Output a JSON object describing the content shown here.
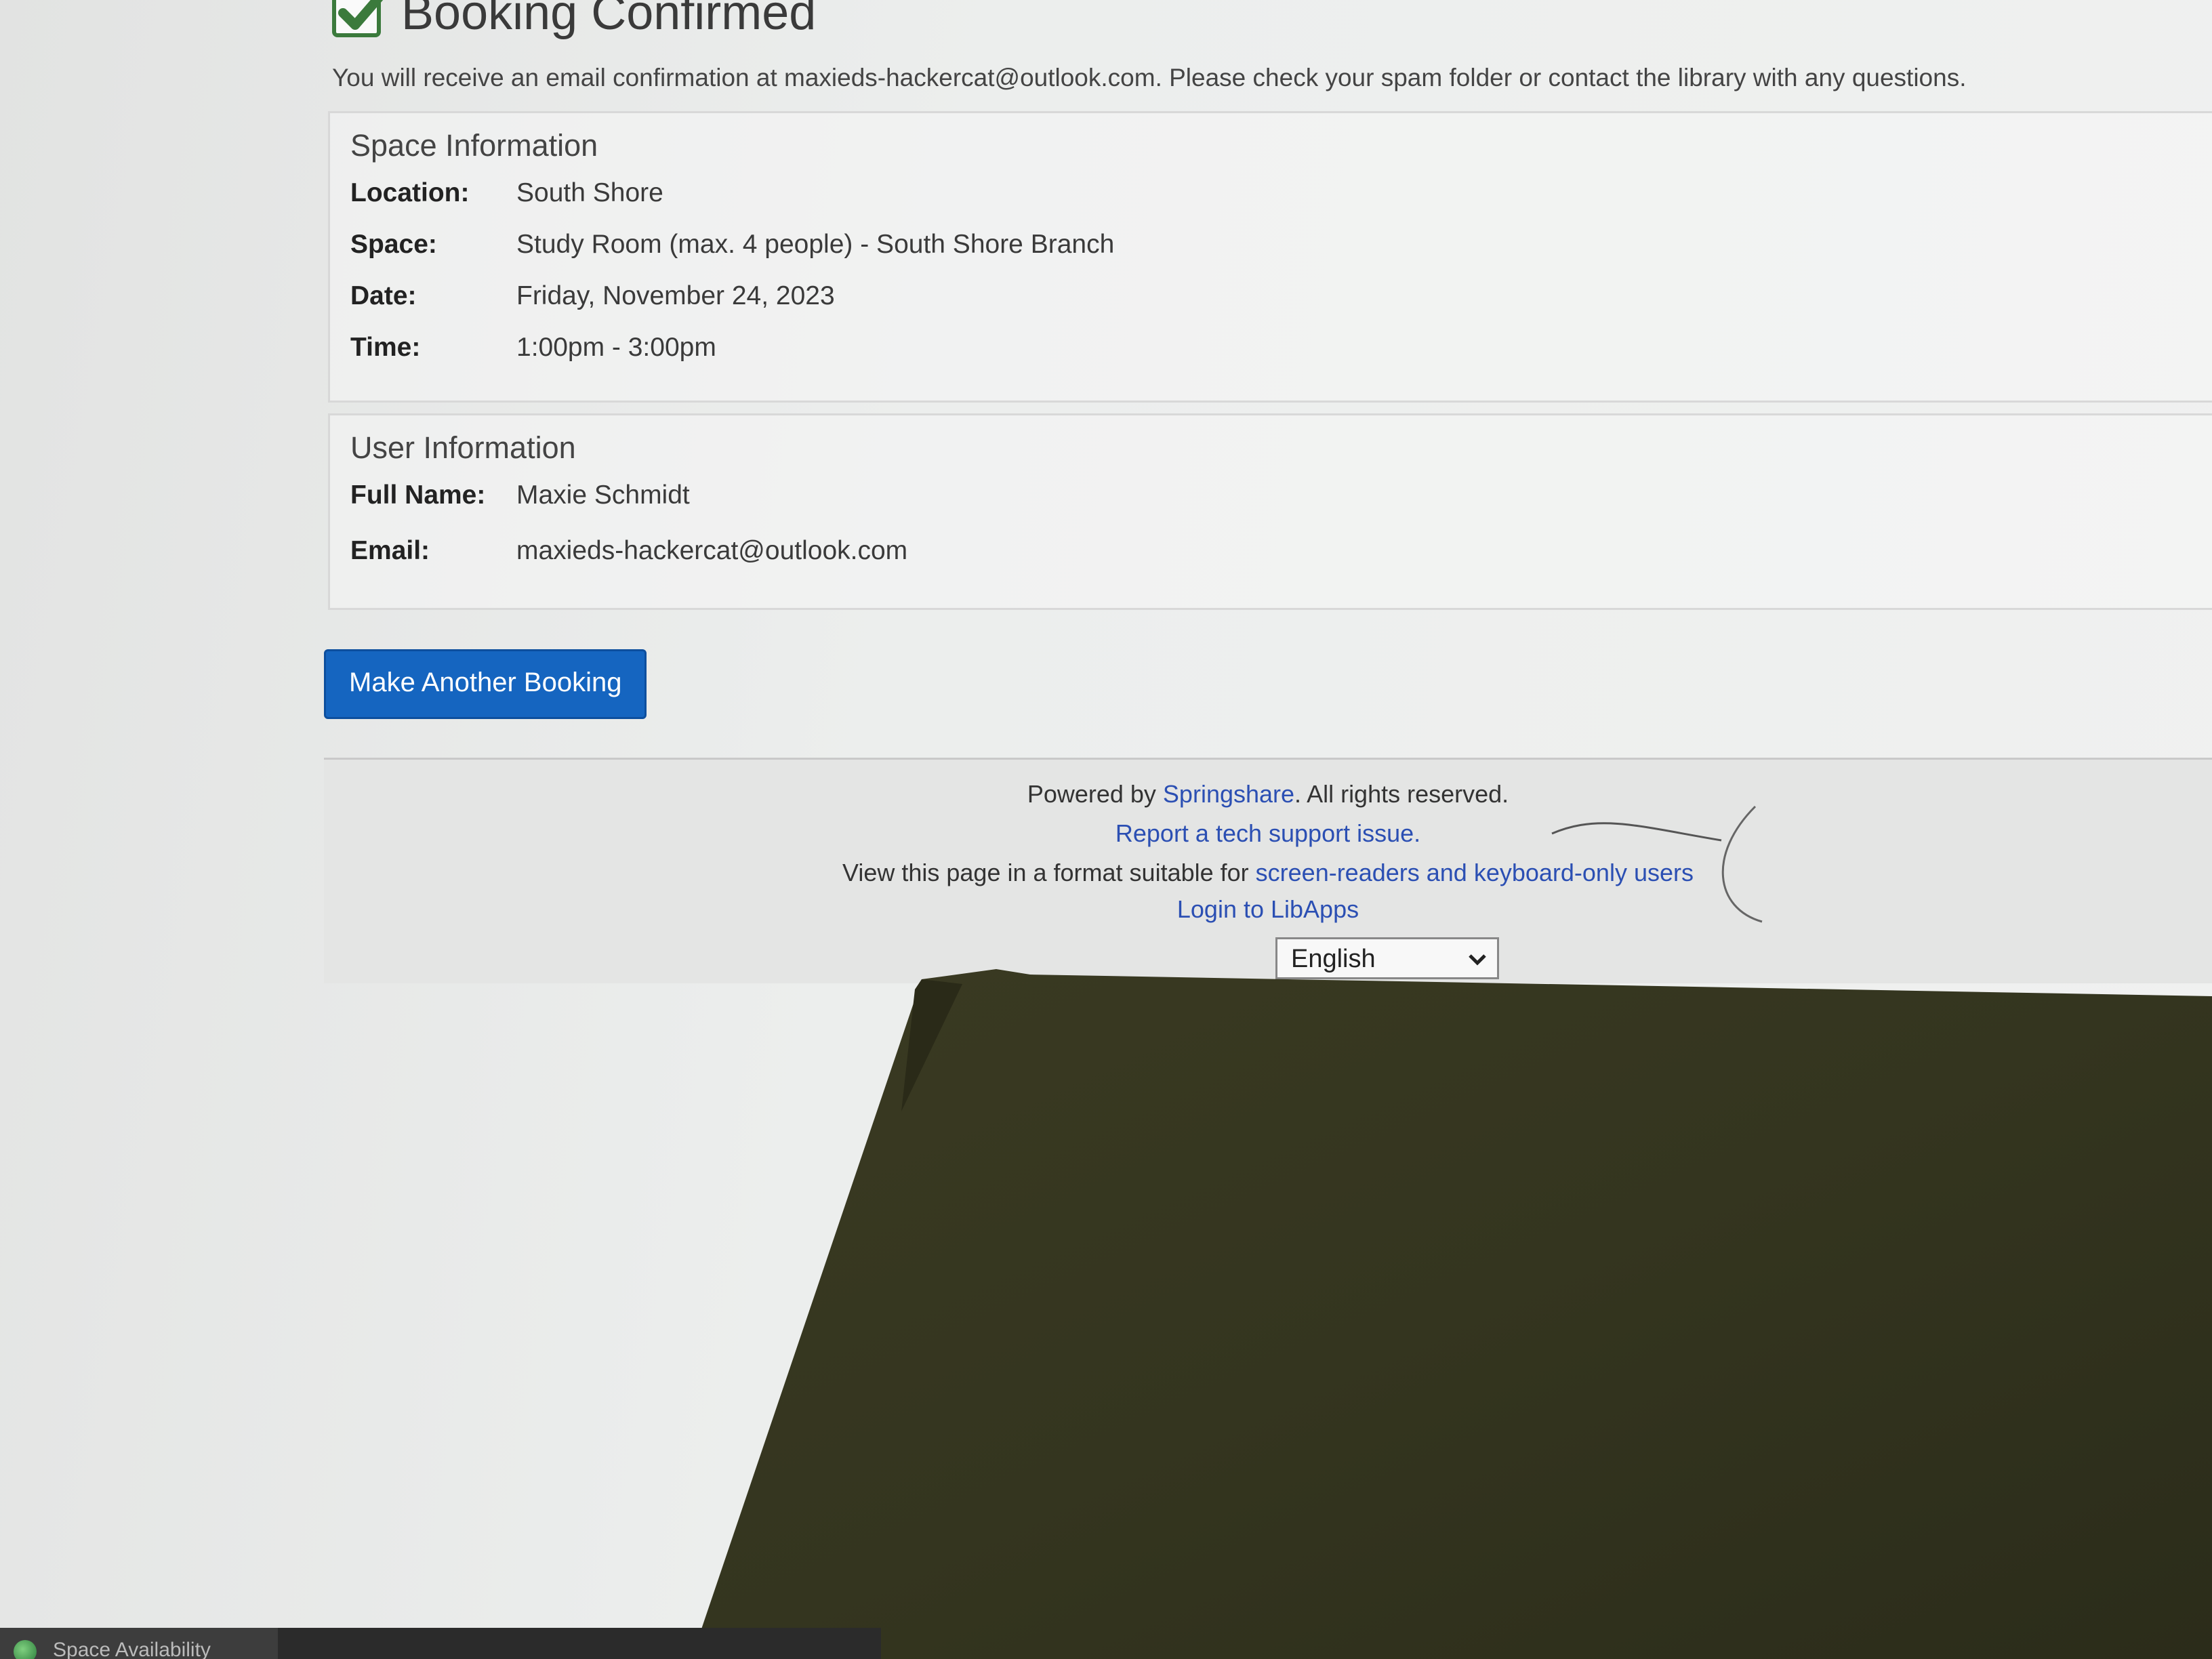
{
  "confirmation": {
    "title": "Booking Confirmed",
    "intro": "You will receive an email confirmation at maxieds-hackercat@outlook.com. Please check your spam folder or contact the library with any questions."
  },
  "space_info": {
    "heading": "Space Information",
    "rows": [
      {
        "label": "Location:",
        "value": "South Shore"
      },
      {
        "label": "Space:",
        "value": "Study Room (max. 4 people) - South Shore Branch"
      },
      {
        "label": "Date:",
        "value": "Friday, November 24, 2023"
      },
      {
        "label": "Time:",
        "value": "1:00pm - 3:00pm"
      }
    ]
  },
  "user_info": {
    "heading": "User Information",
    "rows": [
      {
        "label": "Full Name:",
        "value": "Maxie Schmidt"
      },
      {
        "label": "Email:",
        "value": "maxieds-hackercat@outlook.com"
      }
    ]
  },
  "actions": {
    "make_another_booking": "Make Another Booking"
  },
  "footer": {
    "powered_by_prefix": "Powered by ",
    "springshare_link": "Springshare",
    "rights": ". All rights reserved.",
    "report_link": "Report a tech support issue.",
    "format_prefix": "View this page in a format suitable for ",
    "accessible_link": "screen-readers and keyboard-only users",
    "login_link": "Login to LibApps",
    "language_selected": "English"
  },
  "taskbar": {
    "item_label": "Space Availability"
  },
  "colors": {
    "primary_button": "#1565c0",
    "link": "#2b4fb3",
    "check_green": "#3b7a3c",
    "overlay_object": "#3b3b22"
  },
  "icons": {
    "confirmed": "checkbox-checked-icon",
    "dropdown": "chevron-down-icon",
    "taskbar": "globe-icon"
  }
}
